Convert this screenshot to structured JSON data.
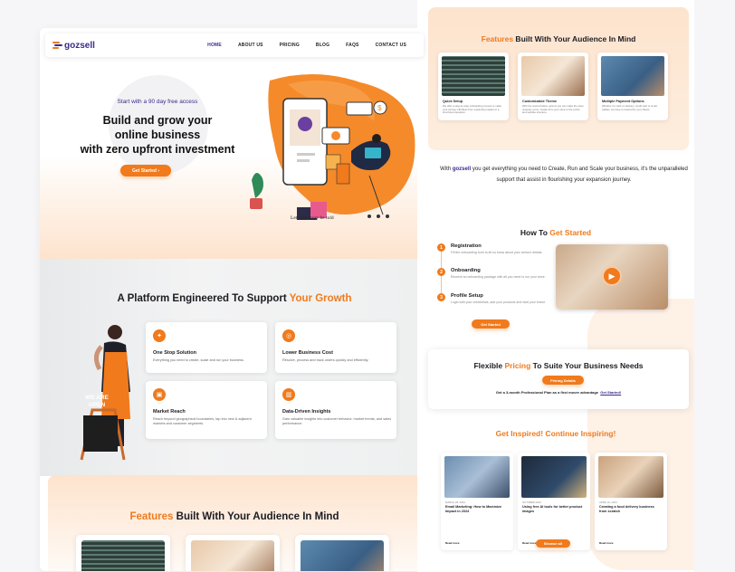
{
  "nav": {
    "logo": "gozsell",
    "links": [
      "HOME",
      "ABOUT US",
      "PRICING",
      "BLOG",
      "FAQS",
      "CONTACT US"
    ]
  },
  "hero": {
    "subtitle": "Start with a 90 day free access",
    "title_line1": "Build and grow your",
    "title_line2": "online business",
    "title_line3": "with zero upfront investment",
    "cta": "Get Started",
    "tagline": "Let your story be told"
  },
  "platform": {
    "title_prefix": "A Platform Engineered To Support ",
    "title_accent": "Your Growth",
    "sign": "WE ARE OPEN",
    "cards": [
      {
        "title": "One Stop Solution",
        "desc": "Everything you need to create, scale and run your business."
      },
      {
        "title": "Lower Business Cost",
        "desc": "Resolve, process and track orders quickly and efficiently."
      },
      {
        "title": "Market Reach",
        "desc": "Reach beyond geographical boundaries, tap into new & adjacent markets and customer segments."
      },
      {
        "title": "Data-Driven Insights",
        "desc": "Gain valuable insights into customer behavior, market trends, and sales performance."
      }
    ]
  },
  "features": {
    "title_accent": "Features",
    "title_rest": " Built With Your Audience In Mind",
    "cards": [
      {
        "title": "Quick Setup",
        "desc": "We offer a step-by-step onboarding process to make your journey effortless from expanding market to a structured operation."
      },
      {
        "title": "Customizable Theme",
        "desc": "With the customization options you can make the store uniquely yours. Create from your store to the colors and website structure."
      },
      {
        "title": "Multiple Payment Options",
        "desc": "Whether it's cash on delivery, credit card or smart wallets, we have it covered for your clients."
      }
    ]
  },
  "with_text": {
    "prefix": "With",
    "logo": "gozsell",
    "rest": " you get everything you need to Create, Run and Scale your business, it's the unparalleled support that assist in flourishing your expansion journey."
  },
  "how": {
    "title_prefix": "How To ",
    "title_accent": "Get Started",
    "steps": [
      {
        "num": "1",
        "title": "Registration",
        "desc": "Fill the onboarding form to let us know about your venture details."
      },
      {
        "num": "2",
        "title": "Onboarding",
        "desc": "Receive an onboarding package with all you need to run your store."
      },
      {
        "num": "3",
        "title": "Profile Setup",
        "desc": "Login with your credentials, add your products and start your brand."
      }
    ],
    "cta": "Get Started"
  },
  "pricing": {
    "title_prefix": "Flexible ",
    "title_accent": "Pricing",
    "title_rest": " To Suite Your Business Needs",
    "button": "Pricing Details",
    "text": "Get a 3-month Professional Plan as a first mover advantage",
    "link": "Get Started!"
  },
  "inspired": {
    "title": "Get Inspired! Continue Inspiring!",
    "posts": [
      {
        "date": "MARCH 28, 2024",
        "title": "Email Marketing: How to Maximize Impact in 2024",
        "more": "Read more"
      },
      {
        "date": "OCTOBER 2024",
        "title": "Using free AI tools for better product images",
        "more": "Read more"
      },
      {
        "date": "APRIL 10, 2024",
        "title": "Creating a food delivery business from scratch",
        "more": "Read more"
      }
    ],
    "browse": "Browse all"
  },
  "colors": {
    "accent": "#f07a1c",
    "brand": "#3a2a8a"
  }
}
